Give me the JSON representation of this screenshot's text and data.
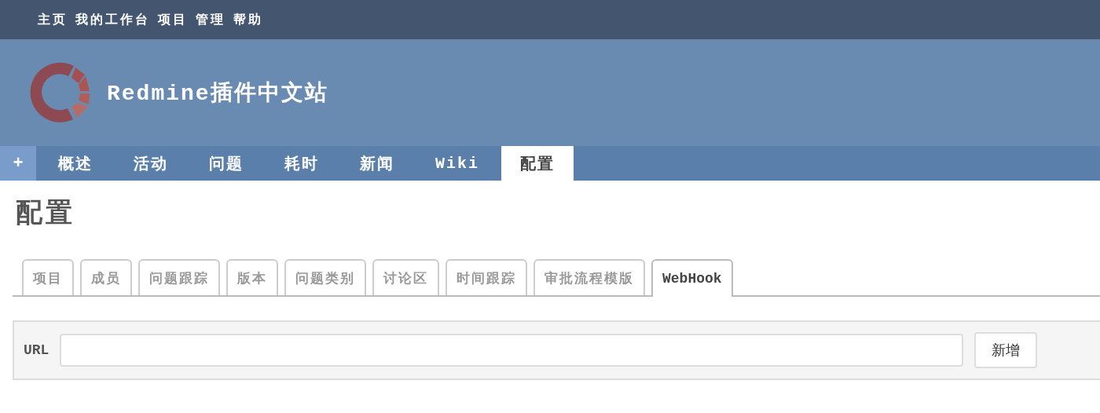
{
  "top_menu": [
    "主页",
    "我的工作台",
    "项目",
    "管理",
    "帮助"
  ],
  "header": {
    "title": "Redmine插件中文站"
  },
  "main_menu": {
    "new_button": "+",
    "items": [
      {
        "label": "概述",
        "selected": false
      },
      {
        "label": "活动",
        "selected": false
      },
      {
        "label": "问题",
        "selected": false
      },
      {
        "label": "耗时",
        "selected": false
      },
      {
        "label": "新闻",
        "selected": false
      },
      {
        "label": "Wiki",
        "selected": false
      },
      {
        "label": "配置",
        "selected": true
      }
    ]
  },
  "page_title": "配置",
  "tabs": [
    {
      "label": "项目",
      "selected": false
    },
    {
      "label": "成员",
      "selected": false
    },
    {
      "label": "问题跟踪",
      "selected": false
    },
    {
      "label": "版本",
      "selected": false
    },
    {
      "label": "问题类别",
      "selected": false
    },
    {
      "label": "讨论区",
      "selected": false
    },
    {
      "label": "时间跟踪",
      "selected": false
    },
    {
      "label": "审批流程模版",
      "selected": false
    },
    {
      "label": "WebHook",
      "selected": true
    }
  ],
  "form": {
    "label": "URL",
    "add_button": "新增"
  }
}
